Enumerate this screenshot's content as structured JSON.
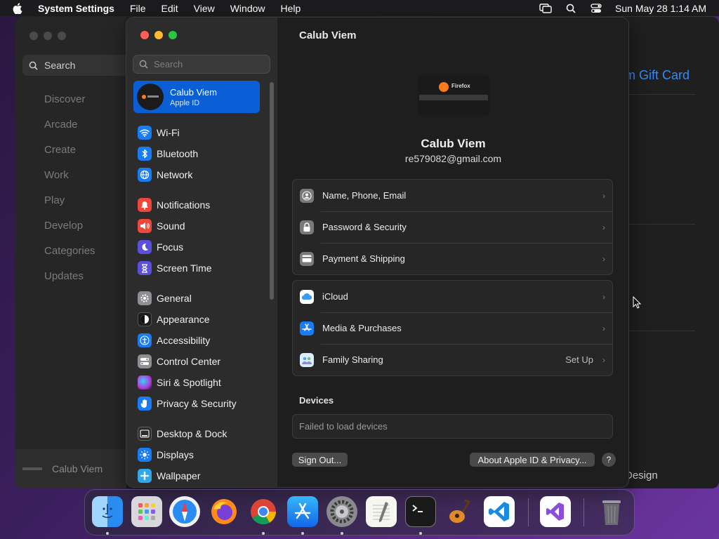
{
  "menubar": {
    "app_name": "System Settings",
    "menus": [
      "File",
      "Edit",
      "View",
      "Window",
      "Help"
    ],
    "clock": "Sun May 28  1:14 AM"
  },
  "background_window": {
    "search_label": "Search",
    "nav": [
      "Discover",
      "Arcade",
      "Create",
      "Work",
      "Play",
      "Develop",
      "Categories",
      "Updates"
    ],
    "user_name": "Calub Viem",
    "link_text": "m Gift Card",
    "footer_text": "Design"
  },
  "sidebar": {
    "search_placeholder": "Search",
    "account": {
      "name": "Calub Viem",
      "subtitle": "Apple ID"
    },
    "items": [
      {
        "label": "Wi-Fi",
        "icon": "wifi-icon",
        "color": "#1a7cf5"
      },
      {
        "label": "Bluetooth",
        "icon": "bluetooth-icon",
        "color": "#1a7cf5"
      },
      {
        "label": "Network",
        "icon": "globe-icon",
        "color": "#1a7cf5"
      },
      {
        "label": "Notifications",
        "icon": "bell-icon",
        "color": "#f0463c"
      },
      {
        "label": "Sound",
        "icon": "speaker-icon",
        "color": "#f0463c"
      },
      {
        "label": "Focus",
        "icon": "moon-icon",
        "color": "#5b4fdc"
      },
      {
        "label": "Screen Time",
        "icon": "hourglass-icon",
        "color": "#5b4fdc"
      },
      {
        "label": "General",
        "icon": "gear-icon",
        "color": "#8e8e93"
      },
      {
        "label": "Appearance",
        "icon": "appearance-icon",
        "color": "#1c1c1c"
      },
      {
        "label": "Accessibility",
        "icon": "accessibility-icon",
        "color": "#1a7cf5"
      },
      {
        "label": "Control Center",
        "icon": "control-center-icon",
        "color": "#8e8e93"
      },
      {
        "label": "Siri & Spotlight",
        "icon": "siri-icon",
        "color": "#b03ad6"
      },
      {
        "label": "Privacy & Security",
        "icon": "hand-icon",
        "color": "#1a7cf5"
      },
      {
        "label": "Desktop & Dock",
        "icon": "dock-icon",
        "color": "#2b2b2b"
      },
      {
        "label": "Displays",
        "icon": "sun-icon",
        "color": "#1a7cf5"
      },
      {
        "label": "Wallpaper",
        "icon": "wallpaper-icon",
        "color": "#2fa7e8"
      }
    ]
  },
  "main": {
    "title": "Calub Viem",
    "thumbnail_label": "Firefox",
    "profile_name": "Calub Viem",
    "profile_email": "re579082@gmail.com",
    "group1": [
      {
        "label": "Name, Phone, Email",
        "icon": "person-icon"
      },
      {
        "label": "Password & Security",
        "icon": "lock-icon"
      },
      {
        "label": "Payment & Shipping",
        "icon": "card-icon"
      }
    ],
    "group2": [
      {
        "label": "iCloud",
        "icon": "icloud-icon"
      },
      {
        "label": "Media & Purchases",
        "icon": "app-store-icon"
      },
      {
        "label": "Family Sharing",
        "icon": "family-icon",
        "extra": "Set Up"
      }
    ],
    "devices_heading": "Devices",
    "devices_status": "Failed to load devices",
    "sign_out": "Sign Out...",
    "about": "About Apple ID & Privacy...",
    "help": "?"
  },
  "dock": {
    "apps": [
      "Finder",
      "Launchpad",
      "Safari",
      "Firefox",
      "Chrome",
      "App Store",
      "System Settings",
      "TextEdit",
      "Terminal",
      "GarageBand",
      "Visual Studio Code",
      "Visual Studio",
      "Trash"
    ]
  }
}
